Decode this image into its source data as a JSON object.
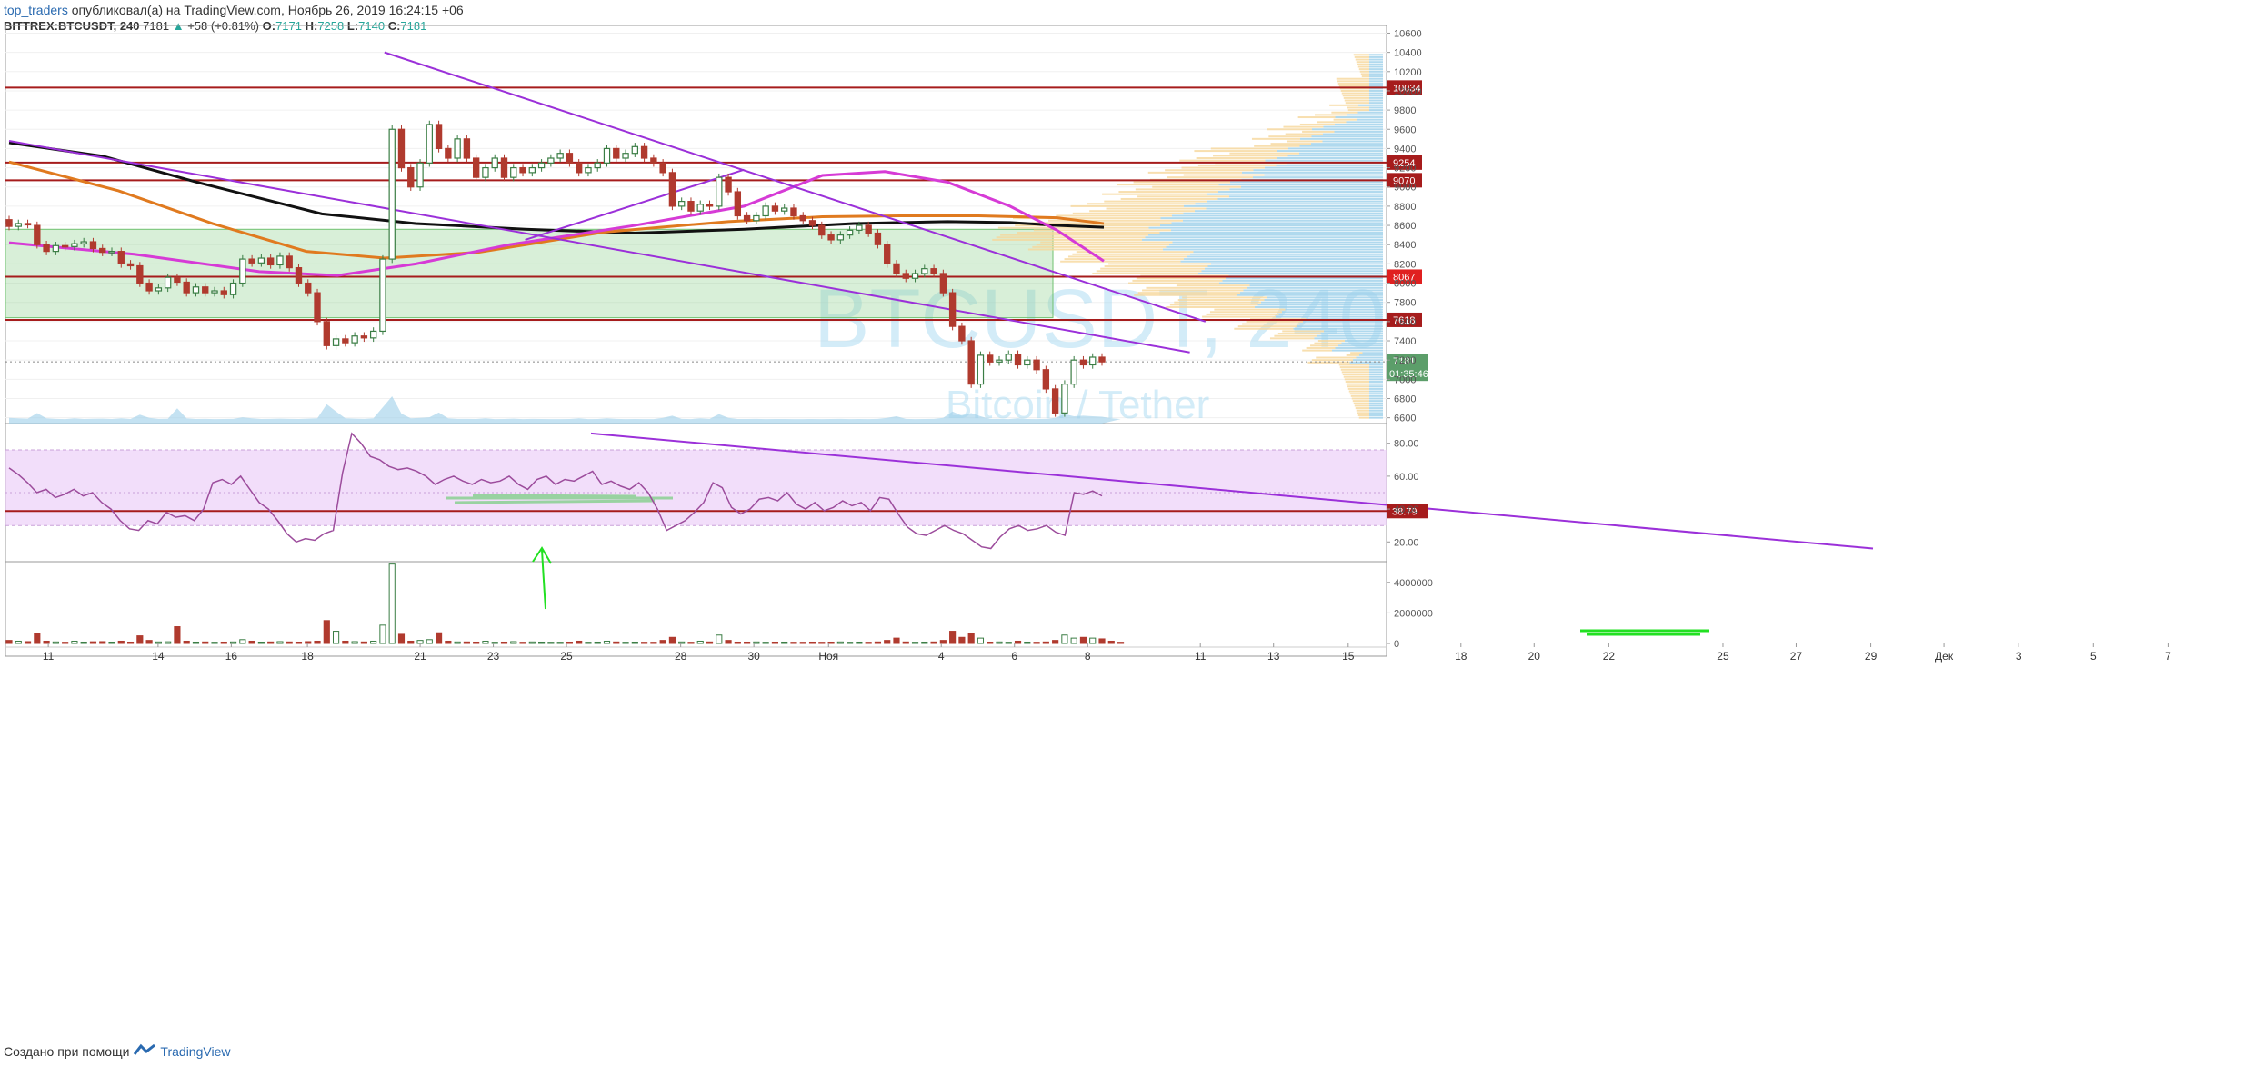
{
  "header": {
    "user": "top_traders",
    "published": "опубликовал(а) на TradingView.com, Ноябрь 26, 2019 16:24:15 +06",
    "symbol": "BITTREX:BTCUSDT, 240",
    "last": "7181",
    "arrow": "▲",
    "change": "+58 (+0.81%)",
    "o_label": "O:",
    "o": "7171",
    "h_label": "H:",
    "h": "7258",
    "l_label": "L:",
    "l": "7140",
    "c_label": "C:",
    "c": "7181"
  },
  "watermark": {
    "symbol": "BTCUSDT, 240",
    "name": "Bitcoin / Tether"
  },
  "footer": {
    "text": "Создано при помощи",
    "brand": "TradingView"
  },
  "colors": {
    "up": "#3a7d44",
    "down": "#b03a2e",
    "level": "#a61c1c",
    "trend": "#9b30d9",
    "ma_black": "#111111",
    "ma_orange": "#e07a1f",
    "ma_magenta": "#d63bd6",
    "zone": "#8fd18f",
    "rsi_line": "#9c4c9c",
    "rsi_band": "#e9c8f7"
  },
  "chart_data": [
    {
      "type": "line",
      "title": "BITTREX:BTCUSDT, 240",
      "series_note": "candlestick",
      "x_ticks": [
        "11",
        "14",
        "16",
        "18",
        "21",
        "23",
        "25",
        "28",
        "30",
        "Ноя",
        "4",
        "6",
        "8",
        "11",
        "13",
        "15",
        "18",
        "20",
        "22",
        "25",
        "27",
        "29",
        "Дек",
        "3",
        "5",
        "7"
      ],
      "y_ticks": [
        "10600",
        "10400",
        "10200",
        "10000",
        "9800",
        "9600",
        "9400",
        "9200",
        "9000",
        "8800",
        "8600",
        "8400",
        "8200",
        "8000",
        "7800",
        "7600",
        "7400",
        "7200",
        "7000",
        "6800",
        "6600"
      ],
      "ylim": [
        6540,
        10680
      ],
      "price_levels": [
        {
          "label": "10034",
          "value": 10034
        },
        {
          "label": "9254",
          "value": 9254
        },
        {
          "label": "9070",
          "value": 9070
        },
        {
          "label": "8067",
          "value": 8067
        },
        {
          "label": "7618",
          "value": 7618
        }
      ],
      "last_price": {
        "label": "7181",
        "value": 7181,
        "timer": "01:35:46"
      },
      "candles": [
        [
          8660,
          8590
        ],
        [
          8590,
          8620
        ],
        [
          8620,
          8610
        ],
        [
          8600,
          8400
        ],
        [
          8400,
          8330
        ],
        [
          8330,
          8390
        ],
        [
          8390,
          8380
        ],
        [
          8380,
          8410
        ],
        [
          8410,
          8430
        ],
        [
          8430,
          8360
        ],
        [
          8360,
          8320
        ],
        [
          8320,
          8330
        ],
        [
          8330,
          8200
        ],
        [
          8200,
          8180
        ],
        [
          8180,
          8000
        ],
        [
          8000,
          7920
        ],
        [
          7920,
          7950
        ],
        [
          7950,
          8060
        ],
        [
          8060,
          8010
        ],
        [
          8010,
          7900
        ],
        [
          7900,
          7960
        ],
        [
          7960,
          7900
        ],
        [
          7900,
          7920
        ],
        [
          7920,
          7880
        ],
        [
          7880,
          8000
        ],
        [
          8000,
          8250
        ],
        [
          8250,
          8210
        ],
        [
          8210,
          8260
        ],
        [
          8260,
          8190
        ],
        [
          8190,
          8280
        ],
        [
          8280,
          8160
        ],
        [
          8160,
          8000
        ],
        [
          8000,
          7900
        ],
        [
          7900,
          7600
        ],
        [
          7600,
          7350
        ],
        [
          7350,
          7420
        ],
        [
          7420,
          7380
        ],
        [
          7380,
          7450
        ],
        [
          7450,
          7430
        ],
        [
          7430,
          7500
        ],
        [
          7500,
          8250
        ],
        [
          8250,
          9600
        ],
        [
          9600,
          9200
        ],
        [
          9200,
          9000
        ],
        [
          9000,
          9250
        ],
        [
          9250,
          9650
        ],
        [
          9650,
          9400
        ],
        [
          9400,
          9300
        ],
        [
          9300,
          9500
        ],
        [
          9500,
          9300
        ],
        [
          9300,
          9100
        ],
        [
          9100,
          9200
        ],
        [
          9200,
          9300
        ],
        [
          9300,
          9100
        ],
        [
          9100,
          9200
        ],
        [
          9200,
          9150
        ],
        [
          9150,
          9200
        ],
        [
          9200,
          9250
        ],
        [
          9250,
          9300
        ],
        [
          9300,
          9350
        ],
        [
          9350,
          9250
        ],
        [
          9250,
          9150
        ],
        [
          9150,
          9200
        ],
        [
          9200,
          9250
        ],
        [
          9250,
          9400
        ],
        [
          9400,
          9300
        ],
        [
          9300,
          9350
        ],
        [
          9350,
          9420
        ],
        [
          9420,
          9300
        ],
        [
          9300,
          9250
        ],
        [
          9250,
          9150
        ],
        [
          9150,
          8800
        ],
        [
          8800,
          8850
        ],
        [
          8850,
          8750
        ],
        [
          8750,
          8820
        ],
        [
          8820,
          8800
        ],
        [
          8800,
          9100
        ],
        [
          9100,
          8950
        ],
        [
          8950,
          8700
        ],
        [
          8700,
          8650
        ],
        [
          8650,
          8700
        ],
        [
          8700,
          8800
        ],
        [
          8800,
          8750
        ],
        [
          8750,
          8780
        ],
        [
          8780,
          8700
        ],
        [
          8700,
          8650
        ],
        [
          8650,
          8600
        ],
        [
          8600,
          8500
        ],
        [
          8500,
          8450
        ],
        [
          8450,
          8500
        ],
        [
          8500,
          8550
        ],
        [
          8550,
          8600
        ],
        [
          8600,
          8520
        ],
        [
          8520,
          8400
        ],
        [
          8400,
          8200
        ],
        [
          8200,
          8100
        ],
        [
          8100,
          8050
        ],
        [
          8050,
          8100
        ],
        [
          8100,
          8150
        ],
        [
          8150,
          8100
        ],
        [
          8100,
          7900
        ],
        [
          7900,
          7550
        ],
        [
          7550,
          7400
        ],
        [
          7400,
          6950
        ],
        [
          6950,
          7250
        ],
        [
          7250,
          7180
        ],
        [
          7180,
          7200
        ],
        [
          7200,
          7260
        ],
        [
          7260,
          7150
        ],
        [
          7150,
          7200
        ],
        [
          7200,
          7100
        ],
        [
          7100,
          6900
        ],
        [
          6900,
          6650
        ],
        [
          6650,
          6950
        ],
        [
          6950,
          7200
        ],
        [
          7200,
          7150
        ],
        [
          7150,
          7230
        ],
        [
          7230,
          7181
        ]
      ],
      "lines": [
        {
          "name": "",
          "color": "#111111",
          "points": [
            [
              0,
              9460
            ],
            [
              60,
              9320
            ],
            [
              120,
              9050
            ],
            [
              200,
              8720
            ],
            [
              260,
              8620
            ],
            [
              330,
              8560
            ],
            [
              400,
              8520
            ],
            [
              470,
              8560
            ],
            [
              540,
              8620
            ],
            [
              600,
              8640
            ],
            [
              640,
              8630
            ],
            [
              670,
              8600
            ],
            [
              700,
              8580
            ]
          ]
        },
        {
          "name": "",
          "color": "#e07a1f",
          "points": [
            [
              0,
              9260
            ],
            [
              70,
              8960
            ],
            [
              130,
              8620
            ],
            [
              190,
              8330
            ],
            [
              240,
              8260
            ],
            [
              300,
              8320
            ],
            [
              380,
              8530
            ],
            [
              460,
              8640
            ],
            [
              520,
              8690
            ],
            [
              570,
              8700
            ],
            [
              620,
              8700
            ],
            [
              670,
              8680
            ],
            [
              700,
              8620
            ]
          ]
        },
        {
          "name": "",
          "color": "#d63bd6",
          "points": [
            [
              0,
              8420
            ],
            [
              80,
              8300
            ],
            [
              160,
              8120
            ],
            [
              210,
              8080
            ],
            [
              260,
              8200
            ],
            [
              320,
              8400
            ],
            [
              400,
              8600
            ],
            [
              470,
              8800
            ],
            [
              520,
              9120
            ],
            [
              560,
              9160
            ],
            [
              600,
              9050
            ],
            [
              640,
              8800
            ],
            [
              670,
              8550
            ],
            [
              700,
              8230
            ]
          ]
        }
      ],
      "trendlines": [
        {
          "from": [
            240,
            10400
          ],
          "to": [
            765,
            7600
          ]
        },
        {
          "from": [
            0,
            9480
          ],
          "to": [
            755,
            7280
          ]
        },
        {
          "from": [
            330,
            8450
          ],
          "to": [
            470,
            9180
          ]
        }
      ],
      "volume": [
        2,
        3,
        2,
        9,
        3,
        2,
        2,
        3,
        2,
        2,
        3,
        2,
        4,
        2,
        3,
        2,
        2,
        2,
        6,
        2,
        3,
        2,
        2,
        2,
        3,
        4,
        3,
        2,
        2,
        3,
        2,
        2,
        3,
        3,
        9,
        6,
        3,
        3,
        2,
        3,
        7,
        25,
        5,
        3,
        3,
        4,
        7,
        3,
        2,
        2,
        2,
        3,
        2,
        2,
        3,
        2,
        2,
        2,
        2,
        2,
        2,
        3,
        2,
        2,
        3,
        2,
        2,
        2,
        2,
        2,
        3,
        3,
        2,
        2,
        3,
        2,
        5,
        3,
        2,
        2,
        2,
        2,
        2,
        2,
        2,
        2,
        2,
        2,
        2,
        2,
        2,
        2,
        2,
        2,
        3,
        3,
        2,
        2,
        2,
        2,
        3,
        5,
        3,
        6,
        4,
        2,
        2,
        2,
        3,
        2,
        2,
        2,
        3,
        4,
        3,
        3,
        3,
        3,
        3,
        2
      ]
    },
    {
      "type": "line",
      "title": "RSI",
      "y_ticks": [
        "80.00",
        "60.00",
        "40.00",
        "20.00"
      ],
      "ylim": [
        8,
        92
      ],
      "band": [
        30,
        76
      ],
      "level": {
        "label": "38.79",
        "value": 38.79
      },
      "values": [
        65,
        61,
        56,
        50,
        52,
        47,
        49,
        52,
        48,
        50,
        44,
        40,
        33,
        28,
        27,
        33,
        31,
        38,
        35,
        36,
        33,
        40,
        56,
        58,
        55,
        60,
        52,
        44,
        40,
        33,
        25,
        20,
        22,
        21,
        25,
        27,
        62,
        86,
        80,
        72,
        70,
        66,
        64,
        65,
        63,
        60,
        55,
        58,
        60,
        57,
        55,
        58,
        56,
        57,
        60,
        55,
        52,
        58,
        60,
        55,
        58,
        57,
        60,
        63,
        55,
        57,
        54,
        52,
        56,
        50,
        40,
        27,
        30,
        33,
        38,
        44,
        56,
        53,
        41,
        37,
        40,
        46,
        47,
        45,
        50,
        43,
        40,
        44,
        39,
        41,
        45,
        42,
        44,
        39,
        47,
        46,
        37,
        29,
        25,
        24,
        27,
        30,
        27,
        25,
        21,
        17,
        16,
        23,
        28,
        30,
        27,
        28,
        30,
        26,
        24,
        50,
        49,
        51,
        48
      ]
    },
    {
      "type": "bar",
      "title": "Volume",
      "y_ticks": [
        "4000000",
        "2000000",
        "0"
      ],
      "ylim": [
        0,
        5000000
      ],
      "values": [
        200000,
        150000,
        120000,
        650000,
        150000,
        100000,
        80000,
        150000,
        90000,
        110000,
        120000,
        90000,
        150000,
        90000,
        500000,
        200000,
        100000,
        110000,
        1100000,
        150000,
        90000,
        100000,
        80000,
        90000,
        100000,
        250000,
        150000,
        90000,
        100000,
        120000,
        100000,
        90000,
        120000,
        150000,
        1500000,
        800000,
        150000,
        120000,
        100000,
        150000,
        1200000,
        5200000,
        600000,
        150000,
        200000,
        250000,
        700000,
        150000,
        100000,
        100000,
        90000,
        150000,
        80000,
        90000,
        120000,
        80000,
        100000,
        90000,
        80000,
        80000,
        90000,
        150000,
        80000,
        90000,
        150000,
        100000,
        80000,
        90000,
        80000,
        80000,
        200000,
        400000,
        100000,
        80000,
        150000,
        100000,
        550000,
        200000,
        90000,
        90000,
        100000,
        80000,
        90000,
        90000,
        80000,
        80000,
        90000,
        80000,
        90000,
        100000,
        80000,
        90000,
        80000,
        100000,
        200000,
        350000,
        100000,
        80000,
        90000,
        100000,
        200000,
        800000,
        400000,
        650000,
        350000,
        90000,
        100000,
        80000,
        150000,
        90000,
        80000,
        100000,
        200000,
        550000,
        350000,
        400000,
        350000,
        300000,
        150000,
        80000
      ]
    }
  ]
}
